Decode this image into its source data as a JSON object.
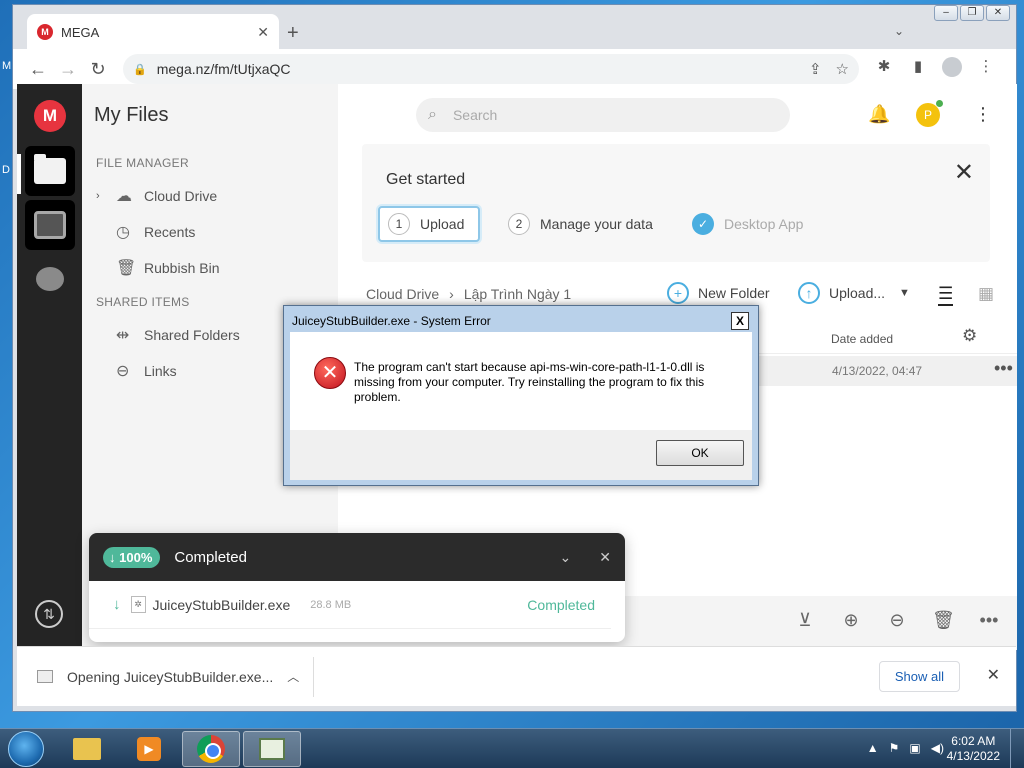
{
  "desktop": {
    "edge_text_1": "M",
    "edge_text_2": "D"
  },
  "browser": {
    "tab_title": "MEGA",
    "tab_logo": "M",
    "url": "mega.nz/fm/tUtjxaQC",
    "window_controls": [
      "minimize-icon",
      "restore-icon",
      "close-icon"
    ]
  },
  "mega": {
    "logo": "M",
    "sidebar": {
      "title": "My Files",
      "file_manager_label": "FILE MANAGER",
      "items": [
        {
          "label": "Cloud Drive",
          "icon": "cloud-icon"
        },
        {
          "label": "Recents",
          "icon": "clock-icon"
        },
        {
          "label": "Rubbish Bin",
          "icon": "trash-icon"
        }
      ],
      "shared_label": "SHARED ITEMS",
      "shared_items": [
        {
          "label": "Shared Folders",
          "icon": "shared-folder-icon"
        },
        {
          "label": "Links",
          "icon": "link-icon"
        }
      ]
    },
    "search_placeholder": "Search",
    "avatar_letter": "P",
    "get_started": {
      "title": "Get started",
      "steps": [
        {
          "num": "1",
          "label": "Upload"
        },
        {
          "num": "2",
          "label": "Manage your data"
        },
        {
          "label": "Desktop App"
        }
      ]
    },
    "breadcrumb": {
      "root": "Cloud Drive",
      "current": "Lập Trình Ngày 1"
    },
    "new_folder": "New Folder",
    "upload": "Upload...",
    "date_header": "Date added",
    "row_date": "4/13/2022, 04:47"
  },
  "transfer": {
    "percent": "100%",
    "title": "Completed",
    "file_name": "JuiceyStubBuilder.exe",
    "file_size": "28.8 MB",
    "status": "Completed"
  },
  "shelf": {
    "download_text": "Opening JuiceyStubBuilder.exe...",
    "show_all": "Show all"
  },
  "dialog": {
    "title": "JuiceyStubBuilder.exe - System Error",
    "message": "The program can't start because api-ms-win-core-path-l1-1-0.dll is missing from your computer. Try reinstalling the program to fix this problem.",
    "ok": "OK",
    "close": "X"
  },
  "taskbar": {
    "time": "6:02 AM",
    "date": "4/13/2022"
  }
}
